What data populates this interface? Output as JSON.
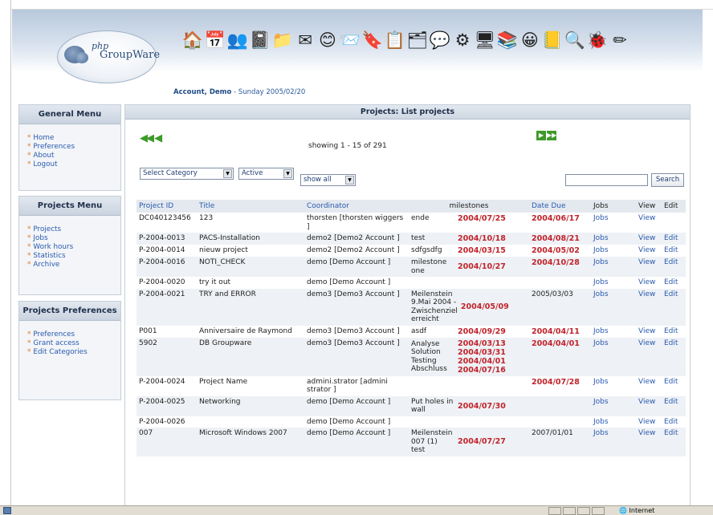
{
  "header": {
    "logo_php": "php",
    "logo_groupware": "GroupWare",
    "user": "Account, Demo",
    "date": " - Sunday 2005/02/20",
    "apps": [
      {
        "name": "home-app-icon",
        "glyph": "🏠"
      },
      {
        "name": "calendar-app-icon",
        "glyph": "📅"
      },
      {
        "name": "contacts-app-icon",
        "glyph": "👥"
      },
      {
        "name": "notes-app-icon",
        "glyph": "📓"
      },
      {
        "name": "filemanager-app-icon",
        "glyph": "📁"
      },
      {
        "name": "email-app-icon",
        "glyph": "✉"
      },
      {
        "name": "smiley-app-icon",
        "glyph": "😊"
      },
      {
        "name": "messenger-app-icon",
        "glyph": "📨"
      },
      {
        "name": "bookmarks-app-icon",
        "glyph": "🔖"
      },
      {
        "name": "todo-app-icon",
        "glyph": "📋"
      },
      {
        "name": "projects-app-icon",
        "glyph": "🗂"
      },
      {
        "name": "forum-app-icon",
        "glyph": "💬"
      },
      {
        "name": "preferences-app-icon",
        "glyph": "⚙"
      },
      {
        "name": "admin-app-icon",
        "glyph": "🖥"
      },
      {
        "name": "manual-app-icon",
        "glyph": "📚"
      },
      {
        "name": "chat-app-icon",
        "glyph": "😀"
      },
      {
        "name": "addressbook-app-icon",
        "glyph": "📒"
      },
      {
        "name": "search-app-icon",
        "glyph": "🔍"
      },
      {
        "name": "bugs-app-icon",
        "glyph": "🐞"
      },
      {
        "name": "logout-app-icon",
        "glyph": "✏"
      }
    ]
  },
  "sidebar": {
    "general": {
      "title": "General Menu",
      "items": [
        "Home",
        "Preferences",
        "About",
        "Logout"
      ]
    },
    "projects": {
      "title": "Projects Menu",
      "items": [
        "Projects",
        "Jobs",
        "Work hours",
        "Statistics",
        "Archive"
      ]
    },
    "prefs": {
      "title": "Projects Preferences",
      "items": [
        "Preferences",
        "Grant access",
        "Edit Categories"
      ]
    }
  },
  "main": {
    "title": "Projects: List projects",
    "showing": "showing 1 - 15 of 291",
    "filters": {
      "category": "Select Category",
      "status": "Active",
      "show": "show all"
    },
    "search_button": "Search",
    "columns": {
      "id": "Project ID",
      "title": "Title",
      "coordinator": "Coordinator",
      "milestones": "milestones",
      "due": "Date Due",
      "jobs": "Jobs",
      "view": "View",
      "edit": "Edit"
    },
    "rows": [
      {
        "id": "DC040123456",
        "title": "123",
        "coord": "thorsten [thorsten wiggers ]",
        "milestones": [
          {
            "n": "ende",
            "d": "2004/07/25"
          }
        ],
        "due": "2004/06/17",
        "due_red": true,
        "jobs": "Jobs",
        "view": "View",
        "edit": ""
      },
      {
        "id": "P-2004-0013",
        "title": "PACS-Installation",
        "coord": "demo2 [Demo2 Account ]",
        "milestones": [
          {
            "n": "test",
            "d": "2004/10/18"
          }
        ],
        "due": "2004/08/21",
        "due_red": true,
        "jobs": "Jobs",
        "view": "View",
        "edit": "Edit"
      },
      {
        "id": "P-2004-0014",
        "title": "nieuw project",
        "coord": "demo2 [Demo2 Account ]",
        "milestones": [
          {
            "n": "sdfgsdfg",
            "d": "2004/03/15"
          }
        ],
        "due": "2004/05/02",
        "due_red": true,
        "jobs": "Jobs",
        "view": "View",
        "edit": "Edit"
      },
      {
        "id": "P-2004-0016",
        "title": "NOTI_CHECK",
        "coord": "demo [Demo Account ]",
        "milestones": [
          {
            "n": "milestone one",
            "d": "2004/10/27"
          }
        ],
        "due": "2004/10/28",
        "due_red": true,
        "jobs": "Jobs",
        "view": "View",
        "edit": "Edit"
      },
      {
        "id": "P-2004-0020",
        "title": "try it out",
        "coord": "demo [Demo Account ]",
        "milestones": [],
        "due": "",
        "due_red": false,
        "jobs": "Jobs",
        "view": "View",
        "edit": "Edit"
      },
      {
        "id": "P-2004-0021",
        "title": "TRY and ERROR",
        "coord": "demo3 [Demo3 Account ]",
        "milestones": [
          {
            "n": "Meilenstein 9.Mai 2004 - Zwischenziel erreicht",
            "d": "2004/05/09"
          }
        ],
        "due": "2005/03/03",
        "due_red": false,
        "jobs": "Jobs",
        "view": "View",
        "edit": "Edit"
      },
      {
        "id": "P001",
        "title": "Anniversaire de Raymond",
        "coord": "demo3 [Demo3 Account ]",
        "milestones": [
          {
            "n": "asdf",
            "d": "2004/09/29"
          }
        ],
        "due": "2004/04/11",
        "due_red": true,
        "jobs": "Jobs",
        "view": "View",
        "edit": "Edit"
      },
      {
        "id": "5902",
        "title": "DB Groupware",
        "coord": "demo3 [Demo3 Account ]",
        "milestones": [
          {
            "n": "Analyse",
            "d": "2004/03/13"
          },
          {
            "n": "Solution",
            "d": "2004/03/31"
          },
          {
            "n": "Testing",
            "d": "2004/04/01"
          },
          {
            "n": "Abschluss",
            "d": "2004/07/16"
          }
        ],
        "due": "2004/04/01",
        "due_red": true,
        "jobs": "Jobs",
        "view": "View",
        "edit": "Edit"
      },
      {
        "id": "P-2004-0024",
        "title": "Project Name",
        "coord": "admini.strator [admini strator ]",
        "milestones": [],
        "due": "2004/07/28",
        "due_red": true,
        "jobs": "Jobs",
        "view": "View",
        "edit": "Edit"
      },
      {
        "id": "P-2004-0025",
        "title": "Networking",
        "coord": "demo [Demo Account ]",
        "milestones": [
          {
            "n": "Put holes in wall",
            "d": "2004/07/30"
          }
        ],
        "due": "",
        "due_red": false,
        "jobs": "Jobs",
        "view": "View",
        "edit": "Edit"
      },
      {
        "id": "P-2004-0026",
        "title": "",
        "coord": "demo [Demo Account ]",
        "milestones": [],
        "due": "",
        "due_red": false,
        "jobs": "Jobs",
        "view": "View",
        "edit": "Edit"
      },
      {
        "id": "007",
        "title": "Microsoft Windows 2007",
        "coord": "demo [Demo Account ]",
        "milestones": [
          {
            "n": "Meilenstein 007 (1)",
            "d": "2004/07/27"
          },
          {
            "n": "test",
            "d": ""
          }
        ],
        "due": "2007/01/01",
        "due_red": false,
        "jobs": "Jobs",
        "view": "View",
        "edit": "Edit"
      }
    ]
  },
  "statusbar": {
    "zone": "Internet"
  },
  "colors": {
    "accent": "#2a5ab0",
    "date_red": "#c0242c",
    "bullet": "#e07a1f",
    "nav_green": "#3e9a2a"
  }
}
